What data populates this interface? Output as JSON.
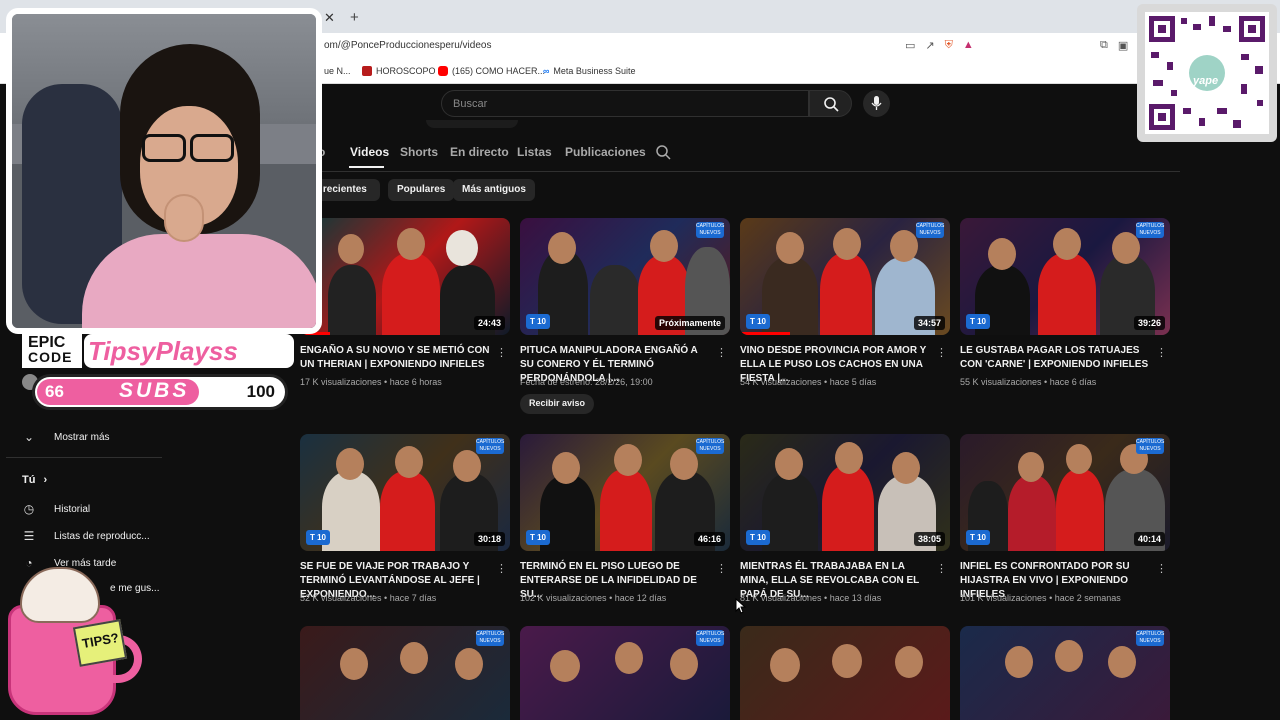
{
  "browser": {
    "url": "om/@PonceProduccionesperu/videos",
    "bookmarks": [
      "ue N...",
      "HOROSCOPO",
      "(165) COMO HACER...",
      "Meta Business Suite"
    ]
  },
  "header": {
    "search_placeholder": "Buscar"
  },
  "channel_tabs": [
    "o",
    "Videos",
    "Shorts",
    "En directo",
    "Listas",
    "Publicaciones"
  ],
  "filters": [
    "ás recientes",
    "Populares",
    "Más antiguos"
  ],
  "videos": [
    {
      "title": "ENGAÑO A SU NOVIO Y SE METIÓ CON UN THERIAN | EXPONIENDO INFIELES",
      "views": "17 K visualizaciones",
      "age": "hace 6 horas",
      "duration": "24:43"
    },
    {
      "title": "PITUCA MANIPULADORA ENGAÑÓ A SU CONERO Y ÉL TERMINÓ PERDONÁNDOLA |...",
      "views": "Fecha de estreno: 28/2/26, 19:00",
      "age": "",
      "duration": "Próximamente",
      "remind": "Recibir aviso"
    },
    {
      "title": "VINO DESDE PROVINCIA POR AMOR Y ELLA LE PUSO LOS CACHOS EN UNA FIESTA |...",
      "views": "54 K visualizaciones",
      "age": "hace 5 días",
      "duration": "34:57"
    },
    {
      "title": "LE GUSTABA PAGAR LOS TATUAJES CON 'CARNE' | EXPONIENDO INFIELES",
      "views": "55 K visualizaciones",
      "age": "hace 6 días",
      "duration": "39:26"
    },
    {
      "title": "SE FUE DE VIAJE POR TRABAJO Y TERMINÓ LEVANTÁNDOSE AL JEFE | EXPONIENDO...",
      "views": "52 K visualizaciones",
      "age": "hace 7 días",
      "duration": "30:18"
    },
    {
      "title": "TERMINÓ EN EL PISO LUEGO DE ENTERARSE DE LA INFIDELIDAD DE SU...",
      "views": "102 K visualizaciones",
      "age": "hace 12 días",
      "duration": "46:16"
    },
    {
      "title": "MIENTRAS ÉL TRABAJABA EN LA MINA, ELLA SE REVOLCABA CON EL PAPÁ DE SU...",
      "views": "81 K visualizaciones",
      "age": "hace 13 días",
      "duration": "38:05"
    },
    {
      "title": "INFIEL ES CONFRONTADO POR SU HIJASTRA EN VIVO | EXPONIENDO INFIELES",
      "views": "101 K visualizaciones",
      "age": "hace 2 semanas",
      "duration": "40:14"
    }
  ],
  "badges": {
    "t10": "T 10",
    "nuevos": "CAPÍTULOS NUEVOS"
  },
  "sidebar": {
    "show_more": "Mostrar más",
    "you": "Tú",
    "items": [
      "Historial",
      "Listas de reproducc...",
      "Ver más tarde",
      "e me gus..."
    ]
  },
  "overlay": {
    "epic": "EPIC",
    "code": "CODE",
    "streamer": "TipsyPlayss",
    "subs_current": "66",
    "subs_label": "SUBS",
    "subs_goal": "100",
    "subs_progress": 0.66,
    "qr_label": "yape",
    "mug_label": "TIPS?"
  },
  "colors": {
    "yt_bg": "#0f0f0f",
    "accent_red": "#ff0000",
    "pink": "#ee5fa0",
    "badge_blue": "#1b6ad1"
  }
}
